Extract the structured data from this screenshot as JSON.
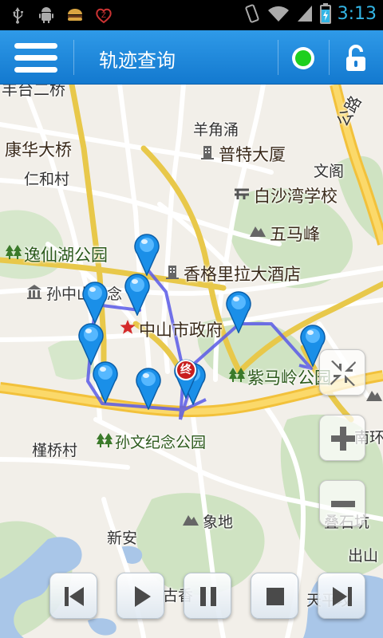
{
  "status_bar": {
    "time": "3:13",
    "icons": [
      "usb-icon",
      "android-debug-icon",
      "burger-app-icon",
      "notification-z-icon",
      "vibrate-icon",
      "wifi-icon",
      "signal-icon",
      "battery-charging-icon"
    ]
  },
  "header": {
    "title": "轨迹查询",
    "status_color": "#1ecf1e",
    "icons": [
      "menu-icon",
      "status-dot",
      "lock-icon"
    ]
  },
  "map": {
    "labels": {
      "top_left_bridge": "丰台二桥",
      "kanghua_bridge": "康华大桥",
      "renhe_village": "仁和村",
      "yangjiaochong": "羊角涌",
      "pute_building": "普特大厦",
      "wenge": "文阁",
      "baishawan_school": "白沙湾学校",
      "wumafeng": "五马峰",
      "yixian_lake_park": "逸仙湖公园",
      "shangri_la": "香格里拉大酒店",
      "sun_memorial": "孙中山纪念",
      "city_gov": "中山市政府",
      "zima_ridge_park": "紫马岭公园",
      "guiqiao_village": "槿桥村",
      "sunwen_park": "孙文纪念公园",
      "xiang_di": "象地",
      "xin_an": "新安",
      "dieshi_keng": "叠石坑",
      "chushan": "出山",
      "guxiang": "古香",
      "tianping": "天平坟",
      "nanhuan": "南环",
      "highway": "公路",
      "end_marker": "终"
    },
    "track_color": "#5a5ae8",
    "pin_color": "#1a8fe8"
  },
  "controls": {
    "collapse": "collapse-icon",
    "zoom_in": "zoom-in-icon",
    "zoom_out": "zoom-out-icon"
  },
  "playback": {
    "buttons": [
      "skip-previous-icon",
      "play-icon",
      "pause-icon",
      "stop-icon",
      "skip-next-icon"
    ]
  }
}
